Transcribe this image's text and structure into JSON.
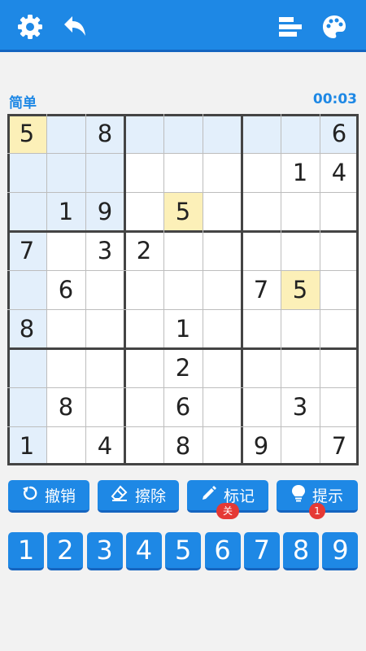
{
  "topbar": {
    "left_icons": [
      "gear-icon",
      "undo-arrow-icon"
    ],
    "right_icons": [
      "stats-bars-icon",
      "palette-icon"
    ]
  },
  "info": {
    "difficulty": "简单",
    "timer": "00:03"
  },
  "colors": {
    "accent": "#1e88e5",
    "highlight": "#e3effb",
    "same_number": "#fcf0b8"
  },
  "board": {
    "selected_cell": [
      0,
      0
    ],
    "grid": [
      [
        "5",
        "",
        "8",
        "",
        "",
        "",
        "",
        "",
        "6"
      ],
      [
        "",
        "",
        "",
        "",
        "",
        "",
        "",
        "1",
        "4"
      ],
      [
        "",
        "1",
        "9",
        "",
        "5",
        "",
        "",
        "",
        ""
      ],
      [
        "7",
        "",
        "3",
        "2",
        "",
        "",
        "",
        "",
        ""
      ],
      [
        "",
        "6",
        "",
        "",
        "",
        "",
        "7",
        "5",
        ""
      ],
      [
        "8",
        "",
        "",
        "",
        "1",
        "",
        "",
        "",
        ""
      ],
      [
        "",
        "",
        "",
        "",
        "2",
        "",
        "",
        "",
        ""
      ],
      [
        "",
        "8",
        "",
        "",
        "6",
        "",
        "",
        "3",
        ""
      ],
      [
        "1",
        "",
        "4",
        "",
        "8",
        "",
        "9",
        "",
        "7"
      ]
    ]
  },
  "actions": {
    "undo": {
      "label": "撤销",
      "icon": "undo-icon"
    },
    "erase": {
      "label": "擦除",
      "icon": "eraser-icon"
    },
    "notes": {
      "label": "标记",
      "icon": "pencil-icon",
      "badge": "关"
    },
    "hint": {
      "label": "提示",
      "icon": "lightbulb-icon",
      "badge": "1"
    }
  },
  "numpad": [
    "1",
    "2",
    "3",
    "4",
    "5",
    "6",
    "7",
    "8",
    "9"
  ]
}
